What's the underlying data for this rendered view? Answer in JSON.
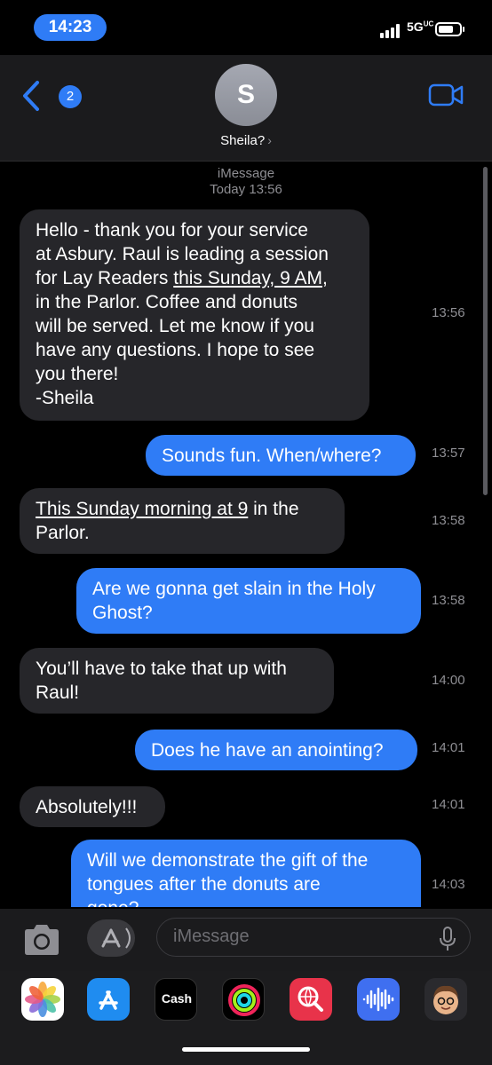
{
  "status": {
    "time": "14:23",
    "network": "5G",
    "network_sup": "UC"
  },
  "header": {
    "back_count": "2",
    "avatar_letter": "S",
    "contact_name": "Sheila?",
    "name_chevron": "›"
  },
  "thread": {
    "service": "iMessage",
    "date": "Today 13:56",
    "messages": [
      {
        "from": "incoming",
        "lines": [
          "Hello - thank you for your service",
          "at Asbury. Raul is leading a session",
          "for Lay Readers ",
          "this Sunday, 9 AM",
          ",",
          "in the Parlor. Coffee and donuts",
          "will be served. Let me know if you",
          "have any questions. I hope to see",
          "you there!",
          "-Sheila"
        ],
        "time": "13:56"
      },
      {
        "from": "outgoing",
        "text": "Sounds fun. When/where?",
        "time": "13:57"
      },
      {
        "from": "incoming",
        "link": "This Sunday morning at 9",
        "rest": " in the",
        "line2": "Parlor.",
        "time": "13:58"
      },
      {
        "from": "outgoing",
        "line1": "Are we gonna get slain in the Holy",
        "line2": "Ghost?",
        "time": "13:58"
      },
      {
        "from": "incoming",
        "line1": "You’ll have to take that up with",
        "line2": "Raul!",
        "time": "14:00"
      },
      {
        "from": "outgoing",
        "text": "Does he have an anointing?",
        "time": "14:01"
      },
      {
        "from": "incoming",
        "text": "Absolutely!!!",
        "time": "14:01"
      },
      {
        "from": "outgoing",
        "line1": "Will we demonstrate the gift of the",
        "line2": "tongues after the donuts are",
        "line3": "gone?",
        "time": "14:03"
      }
    ]
  },
  "composer": {
    "placeholder": "iMessage"
  },
  "dock": {
    "apps": [
      "photos-icon",
      "app-store-icon",
      "apple-cash-icon",
      "activity-icon",
      "web-search-icon",
      "voice-memos-icon",
      "memoji-icon"
    ],
    "cash_label": "Cash",
    "colors": {
      "accent": "#2f7cf6",
      "incoming": "#26262a"
    }
  }
}
